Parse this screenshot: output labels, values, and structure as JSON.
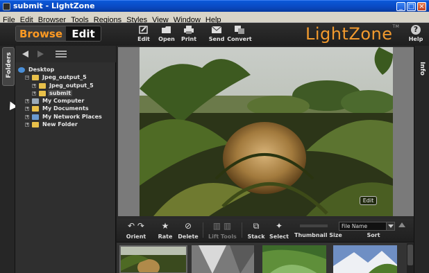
{
  "window": {
    "title": "submit - LightZone",
    "min": "_",
    "max": "□",
    "close": "×"
  },
  "menu": [
    "File",
    "Edit",
    "Browser",
    "Tools",
    "Regions",
    "Styles",
    "View",
    "Window",
    "Help"
  ],
  "toolbar": {
    "browse_label": "Browse",
    "edit_label": "Edit",
    "buttons": [
      {
        "label": "Edit",
        "icon": "edit-icon"
      },
      {
        "label": "Open",
        "icon": "open-icon"
      },
      {
        "label": "Print",
        "icon": "print-icon"
      },
      {
        "label": "Send",
        "icon": "send-icon"
      },
      {
        "label": "Convert",
        "icon": "convert-icon"
      }
    ],
    "logo": "LightZone",
    "logo_tm": "TM",
    "help_label": "Help",
    "help_icon": "?"
  },
  "left_tab": "Folders",
  "right_tab": "Info",
  "tree": [
    {
      "label": "Desktop",
      "icon": "desktop-icon",
      "level": 0,
      "expander": ""
    },
    {
      "label": "Jpeg_output_5",
      "icon": "folder-icon",
      "level": 1,
      "expander": "−"
    },
    {
      "label": "Jpeg_output_5",
      "icon": "folder-icon",
      "level": 2,
      "expander": "+"
    },
    {
      "label": "submit",
      "icon": "folder-icon",
      "level": 2,
      "expander": "+",
      "selected": true
    },
    {
      "label": "My Computer",
      "icon": "computer-icon",
      "level": 1,
      "expander": "+"
    },
    {
      "label": "My Documents",
      "icon": "documents-icon",
      "level": 1,
      "expander": "+"
    },
    {
      "label": "My Network Places",
      "icon": "network-icon",
      "level": 1,
      "expander": "+"
    },
    {
      "label": "New Folder",
      "icon": "folder-icon",
      "level": 1,
      "expander": "+"
    }
  ],
  "preview": {
    "edit_badge": "Edit"
  },
  "browse_toolbar": {
    "orient_label": "Orient",
    "rate_label": "Rate",
    "delete_label": "Delete",
    "lift_label": "Lift Tools",
    "stack_label": "Stack",
    "select_label": "Select",
    "thumb_size_label": "Thumbnail Size",
    "sort_label": "Sort",
    "sort_value": "File Name",
    "rate_icon": "★",
    "delete_icon": "⊘",
    "orient_left_icon": "↶",
    "orient_right_icon": "↷"
  },
  "colors": {
    "accent": "#f29a2e",
    "titlebar": "#0a48c0",
    "panel": "#2f2f2f"
  }
}
